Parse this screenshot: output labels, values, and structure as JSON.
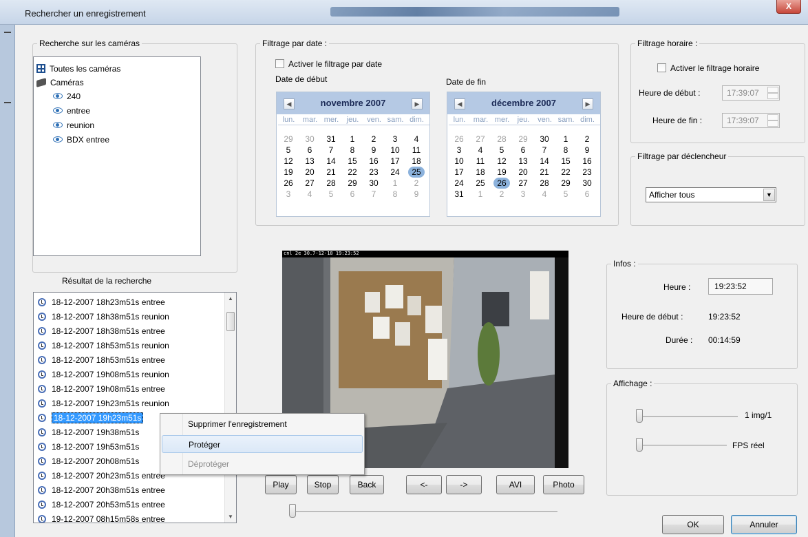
{
  "window": {
    "title": "Rechercher un enregistrement",
    "close_label": "X"
  },
  "cameras": {
    "legend": "Recherche sur les caméras",
    "tree": [
      "Toutes les caméras",
      "Caméras",
      "240",
      "entree",
      "reunion",
      "BDX entree"
    ]
  },
  "date_filter": {
    "legend": "Filtrage par date :",
    "enable_label": "Activer le filtrage par date",
    "start_label": "Date de début",
    "end_label": "Date de fin",
    "weekdays": [
      "lun.",
      "mar.",
      "mer.",
      "jeu.",
      "ven.",
      "sam.",
      "dim."
    ],
    "start_cal": {
      "month": "novembre 2007",
      "days": [
        "29",
        "30",
        "31",
        "1",
        "2",
        "3",
        "4",
        "5",
        "6",
        "7",
        "8",
        "9",
        "10",
        "11",
        "12",
        "13",
        "14",
        "15",
        "16",
        "17",
        "18",
        "19",
        "20",
        "21",
        "22",
        "23",
        "24",
        "25",
        "26",
        "27",
        "28",
        "29",
        "30",
        "1",
        "2",
        "3",
        "4",
        "5",
        "6",
        "7",
        "8",
        "9"
      ],
      "first_in_month": 3,
      "last_in_month": 32,
      "selected": 27
    },
    "end_cal": {
      "month": "décembre 2007",
      "days": [
        "26",
        "27",
        "28",
        "29",
        "30",
        "1",
        "2",
        "3",
        "4",
        "5",
        "6",
        "7",
        "8",
        "9",
        "10",
        "11",
        "12",
        "13",
        "14",
        "15",
        "16",
        "17",
        "18",
        "19",
        "20",
        "21",
        "22",
        "23",
        "24",
        "25",
        "26",
        "27",
        "28",
        "29",
        "30",
        "31",
        "1",
        "2",
        "3",
        "4",
        "5",
        "6"
      ],
      "first_in_month": 5,
      "last_in_month": 35,
      "selected": 30
    }
  },
  "time_filter": {
    "legend": "Filtrage horaire :",
    "enable_label": "Activer le filtrage horaire",
    "start_label": "Heure de début :",
    "start_value": "17:39:07",
    "end_label": "Heure de fin :",
    "end_value": "17:39:07"
  },
  "trigger_filter": {
    "legend": "Filtrage par déclencheur",
    "selected": "Afficher tous"
  },
  "results": {
    "title": "Résultat de la recherche",
    "items": [
      "18-12-2007 18h23m51s entree",
      "18-12-2007 18h38m51s reunion",
      "18-12-2007 18h38m51s entree",
      "18-12-2007 18h53m51s reunion",
      "18-12-2007 18h53m51s entree",
      "18-12-2007 19h08m51s reunion",
      "18-12-2007 19h08m51s entree",
      "18-12-2007 19h23m51s reunion",
      "18-12-2007 19h23m51s",
      "18-12-2007 19h38m51s",
      "18-12-2007 19h53m51s",
      "18-12-2007 20h08m51s",
      "18-12-2007 20h23m51s entree",
      "18-12-2007 20h38m51s entree",
      "18-12-2007 20h53m51s entree",
      "19-12-2007 08h15m58s entree"
    ],
    "selected_index": 8
  },
  "context_menu": {
    "items": [
      "Supprimer l'enregistrement",
      "Protéger",
      "Déprotéger"
    ],
    "hover_index": 1,
    "disabled_index": 2
  },
  "video": {
    "overlay_text": "cnl 2e 30.7-12-18 19:23:52"
  },
  "player": {
    "buttons": [
      "Play",
      "Stop",
      "Back",
      "<-",
      "->",
      "AVI",
      "Photo"
    ]
  },
  "infos": {
    "legend": "Infos :",
    "heure_label": "Heure :",
    "heure_value": "19:23:52",
    "start_label": "Heure de début :",
    "start_value": "19:23:52",
    "duree_label": "Durée :",
    "duree_value": "00:14:59"
  },
  "affichage": {
    "legend": "Affichage :",
    "slider1_label": "1 img/1",
    "slider2_label": "FPS réel"
  },
  "footer": {
    "ok": "OK",
    "cancel": "Annuler"
  }
}
